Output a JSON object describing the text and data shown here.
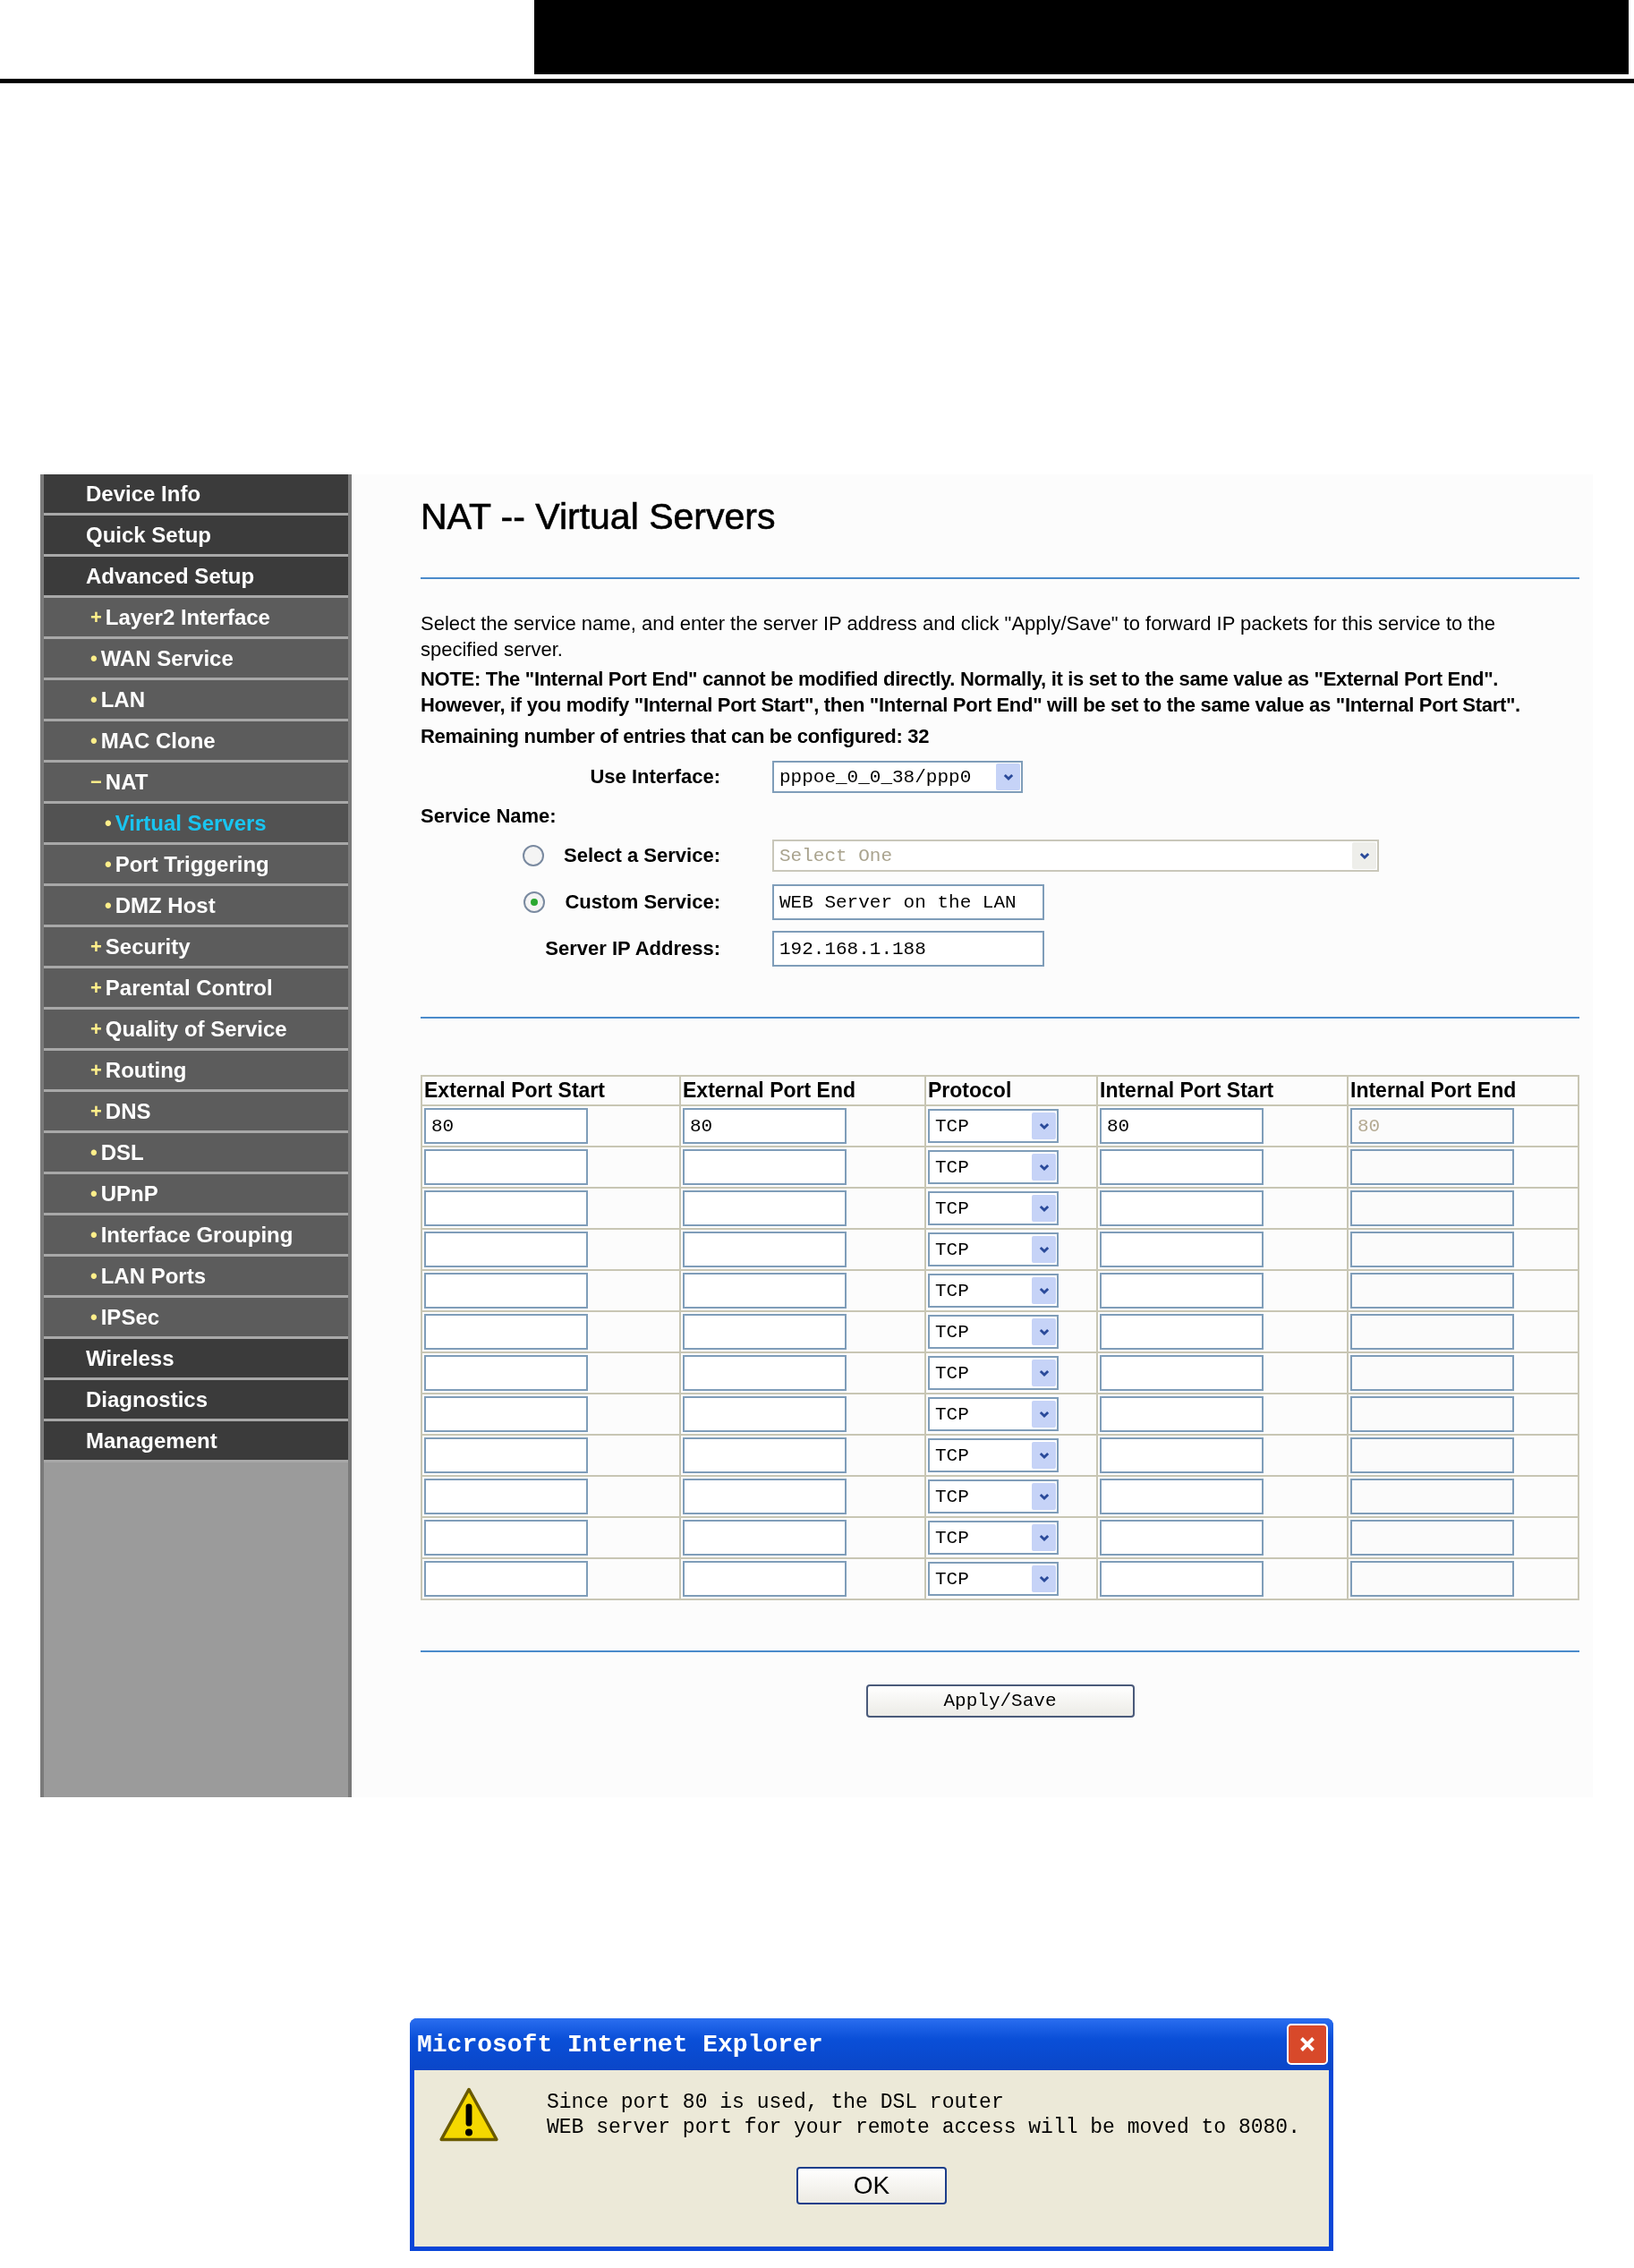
{
  "sidebar": {
    "items": [
      {
        "label": "Device Info",
        "selected": false
      },
      {
        "label": "Quick Setup",
        "selected": false
      },
      {
        "label": "Advanced Setup",
        "selected": false,
        "children": [
          {
            "marker": "+",
            "label": "Layer2 Interface",
            "selected": false
          },
          {
            "marker": "•",
            "label": "WAN Service",
            "selected": false
          },
          {
            "marker": "•",
            "label": "LAN",
            "selected": false
          },
          {
            "marker": "•",
            "label": "MAC Clone",
            "selected": false
          },
          {
            "marker": "−",
            "label": "NAT",
            "selected": false,
            "children": [
              {
                "marker": "•",
                "label": "Virtual Servers",
                "selected": true
              },
              {
                "marker": "•",
                "label": "Port Triggering",
                "selected": false
              },
              {
                "marker": "•",
                "label": "DMZ Host",
                "selected": false
              }
            ]
          },
          {
            "marker": "+",
            "label": "Security",
            "selected": false
          },
          {
            "marker": "+",
            "label": "Parental Control",
            "selected": false
          },
          {
            "marker": "+",
            "label": "Quality of Service",
            "selected": false
          },
          {
            "marker": "+",
            "label": "Routing",
            "selected": false
          },
          {
            "marker": "+",
            "label": "DNS",
            "selected": false
          },
          {
            "marker": "•",
            "label": "DSL",
            "selected": false
          },
          {
            "marker": "•",
            "label": "UPnP",
            "selected": false
          },
          {
            "marker": "•",
            "label": "Interface Grouping",
            "selected": false
          },
          {
            "marker": "•",
            "label": "LAN Ports",
            "selected": false
          },
          {
            "marker": "•",
            "label": "IPSec",
            "selected": false
          }
        ]
      },
      {
        "label": "Wireless",
        "selected": false
      },
      {
        "label": "Diagnostics",
        "selected": false
      },
      {
        "label": "Management",
        "selected": false
      }
    ]
  },
  "page": {
    "title": "NAT -- Virtual Servers",
    "description": "Select the service name, and enter the server IP address and click \"Apply/Save\" to forward IP packets for this service to the specified server.",
    "note": "NOTE: The \"Internal Port End\" cannot be modified directly. Normally, it is set to the same value as \"External Port End\". However, if you modify \"Internal Port Start\", then \"Internal Port End\" will be set to the same value as \"Internal Port Start\".",
    "remaining": "Remaining number of entries that can be configured: 32",
    "use_interface": {
      "label": "Use Interface:",
      "value": "pppoe_0_0_38/ppp0"
    },
    "service_name_label": "Service Name:",
    "service_options": [
      {
        "label": "Select a Service:",
        "selected": false,
        "kind": "dropdown",
        "value": "Select One",
        "disabled": true
      },
      {
        "label": "Custom Service:",
        "selected": true,
        "kind": "text",
        "value": "WEB Server on the LAN",
        "disabled": false
      }
    ],
    "server_ip": {
      "label": "Server IP Address:",
      "value": "192.168.1.188"
    },
    "table": {
      "columns": [
        "External Port Start",
        "External Port End",
        "Protocol",
        "Internal Port Start",
        "Internal Port End"
      ],
      "rows": [
        {
          "external_start": "80",
          "external_end": "80",
          "protocol": "TCP",
          "internal_start": "80",
          "internal_end": "80",
          "internal_end_disabled": true
        },
        {
          "protocol": "TCP",
          "internal_end_disabled": true
        },
        {
          "protocol": "TCP",
          "internal_end_disabled": true
        },
        {
          "protocol": "TCP",
          "internal_end_disabled": true
        },
        {
          "protocol": "TCP",
          "internal_end_disabled": true
        },
        {
          "protocol": "TCP",
          "internal_end_disabled": true
        },
        {
          "protocol": "TCP",
          "internal_end_disabled": true
        },
        {
          "protocol": "TCP",
          "internal_end_disabled": true
        },
        {
          "protocol": "TCP",
          "internal_end_disabled": true
        },
        {
          "protocol": "TCP",
          "internal_end_disabled": true
        },
        {
          "protocol": "TCP",
          "internal_end_disabled": true
        },
        {
          "protocol": "TCP",
          "internal_end_disabled": true
        }
      ]
    },
    "apply_button": "Apply/Save"
  },
  "dialog": {
    "title": "Microsoft Internet Explorer",
    "message_lines": [
      "Since port 80 is used, the DSL router",
      "WEB server port for your remote access will be moved to 8080."
    ],
    "button": "OK"
  }
}
